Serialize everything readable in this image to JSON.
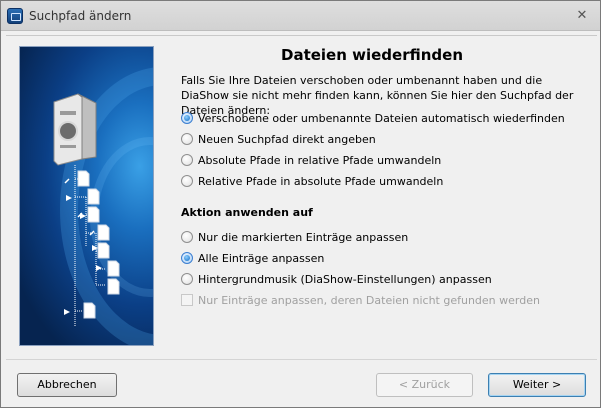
{
  "window": {
    "title": "Suchpfad ändern",
    "close_glyph": "✕"
  },
  "main": {
    "heading": "Dateien wiederfinden",
    "intro": "Falls Sie Ihre Dateien verschoben oder umbenannt haben und die DiaShow sie nicht mehr finden kann, können Sie hier den Suchpfad der Dateien ändern:",
    "path_options": [
      {
        "label": "Verschobene oder umbenannte Dateien automatisch wiederfinden",
        "checked": true
      },
      {
        "label": "Neuen Suchpfad direkt angeben",
        "checked": false
      },
      {
        "label": "Absolute Pfade in relative Pfade umwandeln",
        "checked": false
      },
      {
        "label": "Relative Pfade in absolute Pfade umwandeln",
        "checked": false
      }
    ],
    "apply_heading": "Aktion anwenden auf",
    "apply_options": [
      {
        "label": "Nur die markierten Einträge anpassen",
        "checked": false
      },
      {
        "label": "Alle Einträge anpassen",
        "checked": true
      },
      {
        "label": "Hintergrundmusik (DiaShow-Einstellungen) anpassen",
        "checked": false
      }
    ],
    "checkbox": {
      "label": "Nur Einträge anpassen, deren Dateien nicht gefunden werden",
      "checked": false,
      "enabled": false
    }
  },
  "buttons": {
    "cancel": "Abbrechen",
    "back": "< Zurück",
    "next": "Weiter >"
  },
  "icons": {
    "app": "diashow-app-icon",
    "sidebar_image": "file-tree-illustration"
  },
  "colors": {
    "accent": "#3b7ed0",
    "sidebar_dark": "#062450",
    "sidebar_light": "#3aa0e6"
  }
}
